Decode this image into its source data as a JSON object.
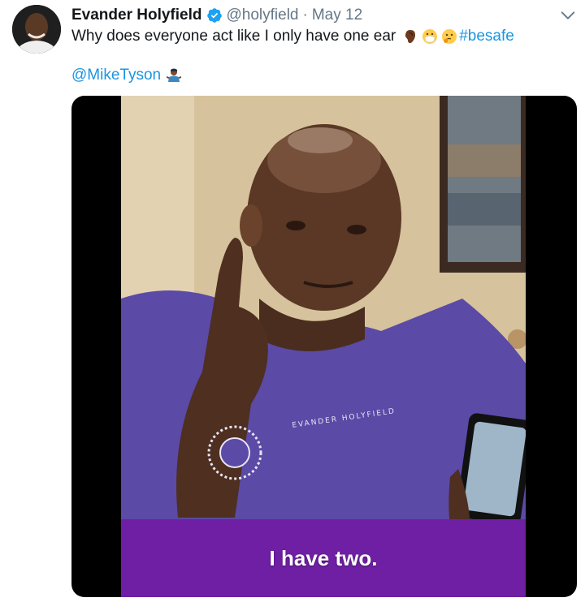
{
  "tweet": {
    "author_name": "Evander Holyfield",
    "handle": "@holyfield",
    "separator": "·",
    "date": "May 12",
    "text": "Why does everyone act like I only have one ear",
    "hashtag": "#besafe",
    "mention": "@MikeTyson",
    "verified": true,
    "emojis": [
      "ear-emoji",
      "mask-face-emoji",
      "thinking-face-emoji",
      "man-shrugging-emoji"
    ]
  },
  "media": {
    "caption": "I have two.",
    "shirt_text": "EVANDER HOLYFIELD"
  },
  "colors": {
    "link": "#1b95e0",
    "secondary_text": "#657786",
    "caption_bar": "#6f1fa3",
    "verified_badge": "#1da1f2"
  }
}
